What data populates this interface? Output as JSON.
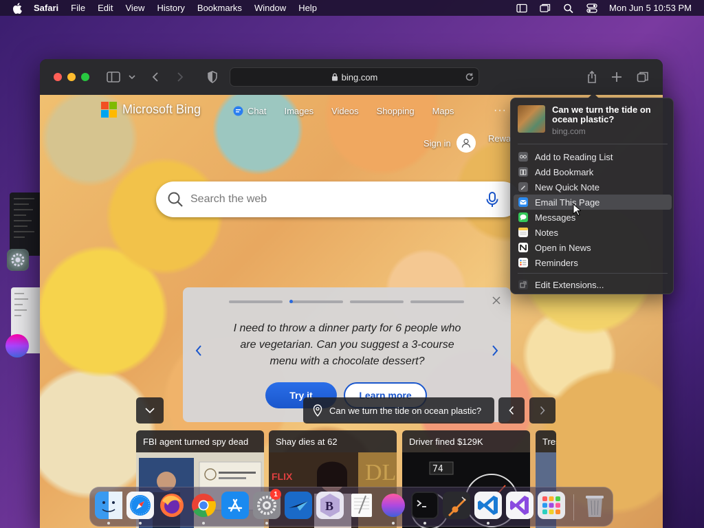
{
  "menubar": {
    "app_name": "Safari",
    "items": [
      "File",
      "Edit",
      "View",
      "History",
      "Bookmarks",
      "Window",
      "Help"
    ],
    "clock": "Mon Jun 5  10:53 PM"
  },
  "toolbar": {
    "url": "bing.com"
  },
  "bing": {
    "logo_text": "Microsoft Bing",
    "nav": [
      "Chat",
      "Images",
      "Videos",
      "Shopping",
      "Maps"
    ],
    "more": "···",
    "signin": "Sign in",
    "rewards": "Rewa",
    "search_placeholder": "Search the web"
  },
  "prompt_card": {
    "text": "I need to throw a dinner party for 6 people who are vegetarian. Can you suggest a 3-course menu with a chocolate dessert?",
    "try_label": "Try it",
    "learn_label": "Learn more"
  },
  "location": {
    "text": "Can we turn the tide on ocean plastic?"
  },
  "news": [
    {
      "title": "FBI agent turned spy dead"
    },
    {
      "title": "Shay dies at 62"
    },
    {
      "title": "Driver fined $129K"
    },
    {
      "title": "Tres"
    }
  ],
  "share_menu": {
    "title": "Can we turn the tide on ocean plastic?",
    "url": "bing.com",
    "items": [
      {
        "label": "Add to Reading List",
        "icon": "glasses-icon"
      },
      {
        "label": "Add Bookmark",
        "icon": "book-icon"
      },
      {
        "label": "New Quick Note",
        "icon": "note-icon"
      },
      {
        "label": "Email This Page",
        "icon": "mail-icon",
        "highlighted": true
      },
      {
        "label": "Messages",
        "icon": "messages-icon"
      },
      {
        "label": "Notes",
        "icon": "notes-icon"
      },
      {
        "label": "Open in News",
        "icon": "news-icon"
      },
      {
        "label": "Reminders",
        "icon": "reminders-icon"
      }
    ],
    "edit_label": "Edit Extensions..."
  },
  "dock": {
    "apps": [
      "Finder",
      "Safari",
      "Firefox",
      "Chrome",
      "App Store",
      "System Settings",
      "Prime",
      "BBEdit",
      "TextEdit",
      "macOS",
      "Terminal",
      "GarageBand",
      "VS Code",
      "Visual Studio",
      "Launchpad",
      "Trash"
    ],
    "settings_badge": "1"
  },
  "colors": {
    "accent": "#1a56cc",
    "ms_red": "#f25022",
    "ms_green": "#7fba00",
    "ms_blue": "#00a4ef",
    "ms_yellow": "#ffb900"
  }
}
